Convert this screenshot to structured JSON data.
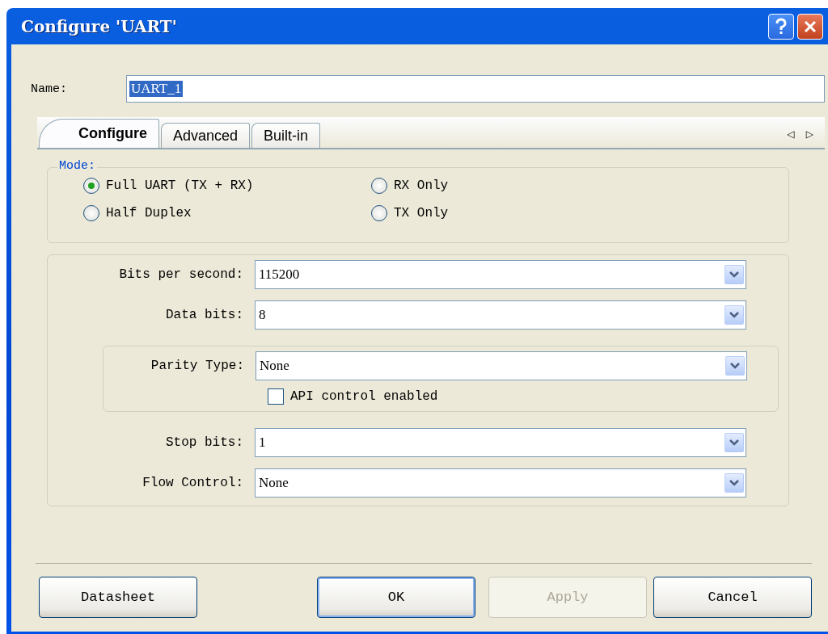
{
  "window": {
    "title": "Configure 'UART'"
  },
  "name": {
    "label": "Name:",
    "value": "UART_1"
  },
  "tabs": [
    {
      "label": "Configure",
      "selected": true
    },
    {
      "label": "Advanced",
      "selected": false
    },
    {
      "label": "Built-in",
      "selected": false
    }
  ],
  "tab_scroll": {
    "left": "◁",
    "right": "▷"
  },
  "mode": {
    "title": "Mode:",
    "options": [
      {
        "label": "Full UART (TX + RX)",
        "selected": true
      },
      {
        "label": "RX Only",
        "selected": false
      },
      {
        "label": "Half Duplex",
        "selected": false
      },
      {
        "label": "TX Only",
        "selected": false
      }
    ]
  },
  "settings_top": [
    {
      "label": "Bits per second:",
      "value": "115200"
    },
    {
      "label": "Data bits:",
      "value": "8"
    }
  ],
  "parity": {
    "label": "Parity Type:",
    "value": "None",
    "checkbox": {
      "label": "API control enabled",
      "checked": false
    }
  },
  "settings_bottom": [
    {
      "label": "Stop bits:",
      "value": "1"
    },
    {
      "label": "Flow Control:",
      "value": "None"
    }
  ],
  "buttons": [
    {
      "label": "Datasheet",
      "disabled": false,
      "default": false
    },
    {
      "label": "OK",
      "disabled": false,
      "default": true
    },
    {
      "label": "Apply",
      "disabled": true,
      "default": false
    },
    {
      "label": "Cancel",
      "disabled": false,
      "default": false
    }
  ]
}
